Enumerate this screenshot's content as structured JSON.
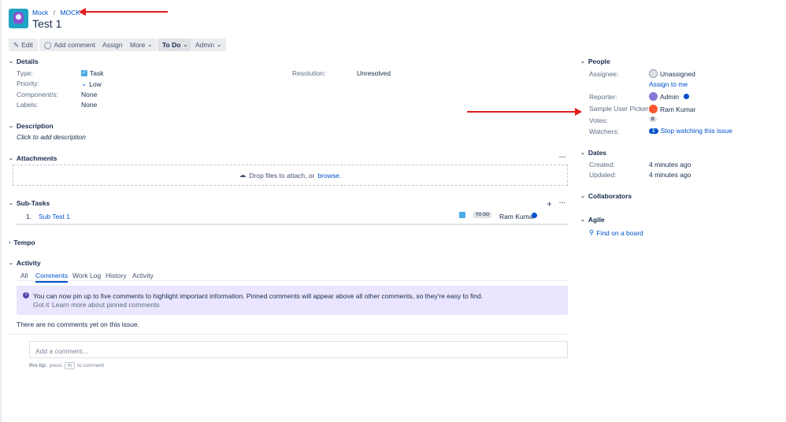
{
  "breadcrumb": {
    "project": "Mock",
    "issue_key": "MOCK-1"
  },
  "title": "Test 1",
  "toolbar": {
    "edit": "Edit",
    "add_comment": "Add comment",
    "assign": "Assign",
    "more": "More",
    "status": "To Do",
    "admin": "Admin"
  },
  "details": {
    "heading": "Details",
    "type_label": "Type:",
    "type": "Task",
    "priority_label": "Priority:",
    "priority": "Low",
    "components_label": "Component/s:",
    "components": "None",
    "labels_label": "Labels:",
    "labels": "None",
    "resolution_label": "Resolution:",
    "resolution": "Unresolved"
  },
  "description": {
    "heading": "Description",
    "placeholder": "Click to add description"
  },
  "attachments": {
    "heading": "Attachments",
    "drop_text": "Drop files to attach, or",
    "browse": "browse."
  },
  "subtasks": {
    "heading": "Sub-Tasks",
    "items": [
      {
        "num": "1.",
        "summary": "Sub Test 1",
        "status": "TO DO",
        "assignee": "Ram Kumar"
      }
    ]
  },
  "tempo": {
    "heading": "Tempo"
  },
  "activity": {
    "heading": "Activity",
    "tabs": [
      "All",
      "Comments",
      "Work Log",
      "History",
      "Activity"
    ],
    "banner": "You can now pin up to five comments to highlight important information. Pinned comments will appear above all other comments, so they're easy to find.",
    "got_it": "Got it",
    "learn_more": "Learn more about pinned comments",
    "empty": "There are no comments yet on this issue.",
    "comment_placeholder": "Add a comment...",
    "pro_tip_label": "Pro tip:",
    "pro_tip_press": "press",
    "pro_tip_key": "m",
    "pro_tip_suffix": "to comment"
  },
  "people": {
    "heading": "People",
    "assignee_label": "Assignee:",
    "assignee": "Unassigned",
    "assign_to_me": "Assign to me",
    "reporter_label": "Reporter:",
    "reporter": "Admin",
    "picker_label": "Sample User Picker:",
    "picker": "Ram Kumar",
    "votes_label": "Votes:",
    "votes": "0",
    "watchers_label": "Watchers:",
    "watchers": "1",
    "stop_watching": "Stop watching this issue"
  },
  "dates": {
    "heading": "Dates",
    "created_label": "Created:",
    "created": "4 minutes ago",
    "updated_label": "Updated:",
    "updated": "4 minutes ago"
  },
  "collaborators": {
    "heading": "Collaborators"
  },
  "agile": {
    "heading": "Agile",
    "find": "Find on a board"
  }
}
